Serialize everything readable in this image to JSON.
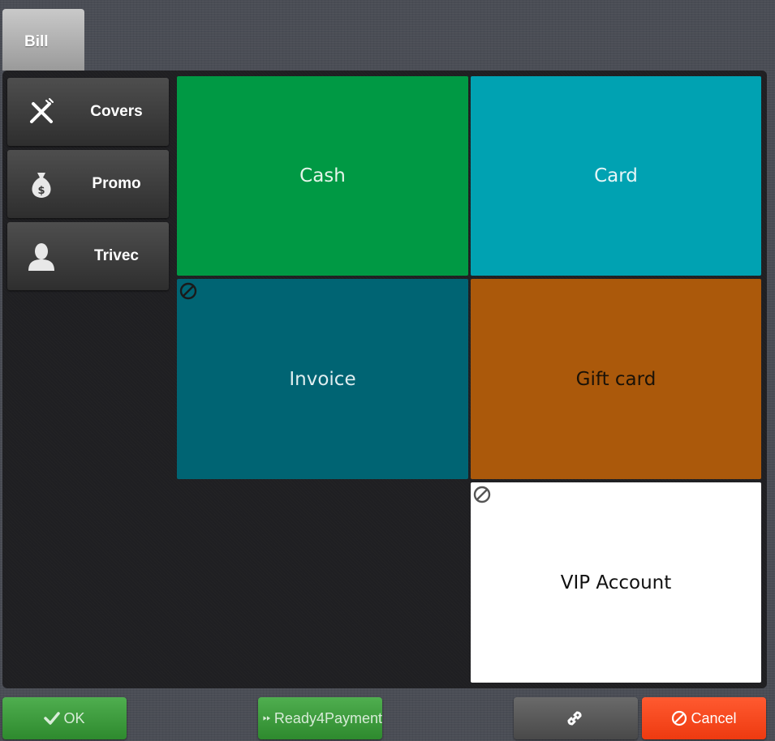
{
  "tabs": [
    {
      "label": "Bill",
      "active": true
    }
  ],
  "side_buttons": [
    {
      "label": "Covers",
      "icon": "cutlery-icon"
    },
    {
      "label": "Promo",
      "icon": "money-bag-icon"
    },
    {
      "label": "Trivec",
      "icon": "user-icon"
    }
  ],
  "payment_tiles": [
    {
      "label": "Cash",
      "color": "#009944",
      "text_color": "#e6f5ea",
      "disabled": false
    },
    {
      "label": "Card",
      "color": "#00a2b2",
      "text_color": "#e6f5f7",
      "disabled": false
    },
    {
      "label": "Invoice",
      "color": "#006473",
      "text_color": "#e0eef0",
      "disabled": true
    },
    {
      "label": "Gift card",
      "color": "#ab590b",
      "text_color": "#1a1208",
      "disabled": false
    },
    {
      "label": "VIP Account",
      "color": "#ffffff",
      "text_color": "#111111",
      "disabled": true
    }
  ],
  "footer": {
    "ok_label": "OK",
    "ready_label": "Ready4Payment",
    "link_icon": "link-icon",
    "cancel_label": "Cancel"
  },
  "colors": {
    "ok_green": "#3a9a3a",
    "cancel_red": "#f44a1f",
    "panel_bg": "#1f1f22"
  }
}
